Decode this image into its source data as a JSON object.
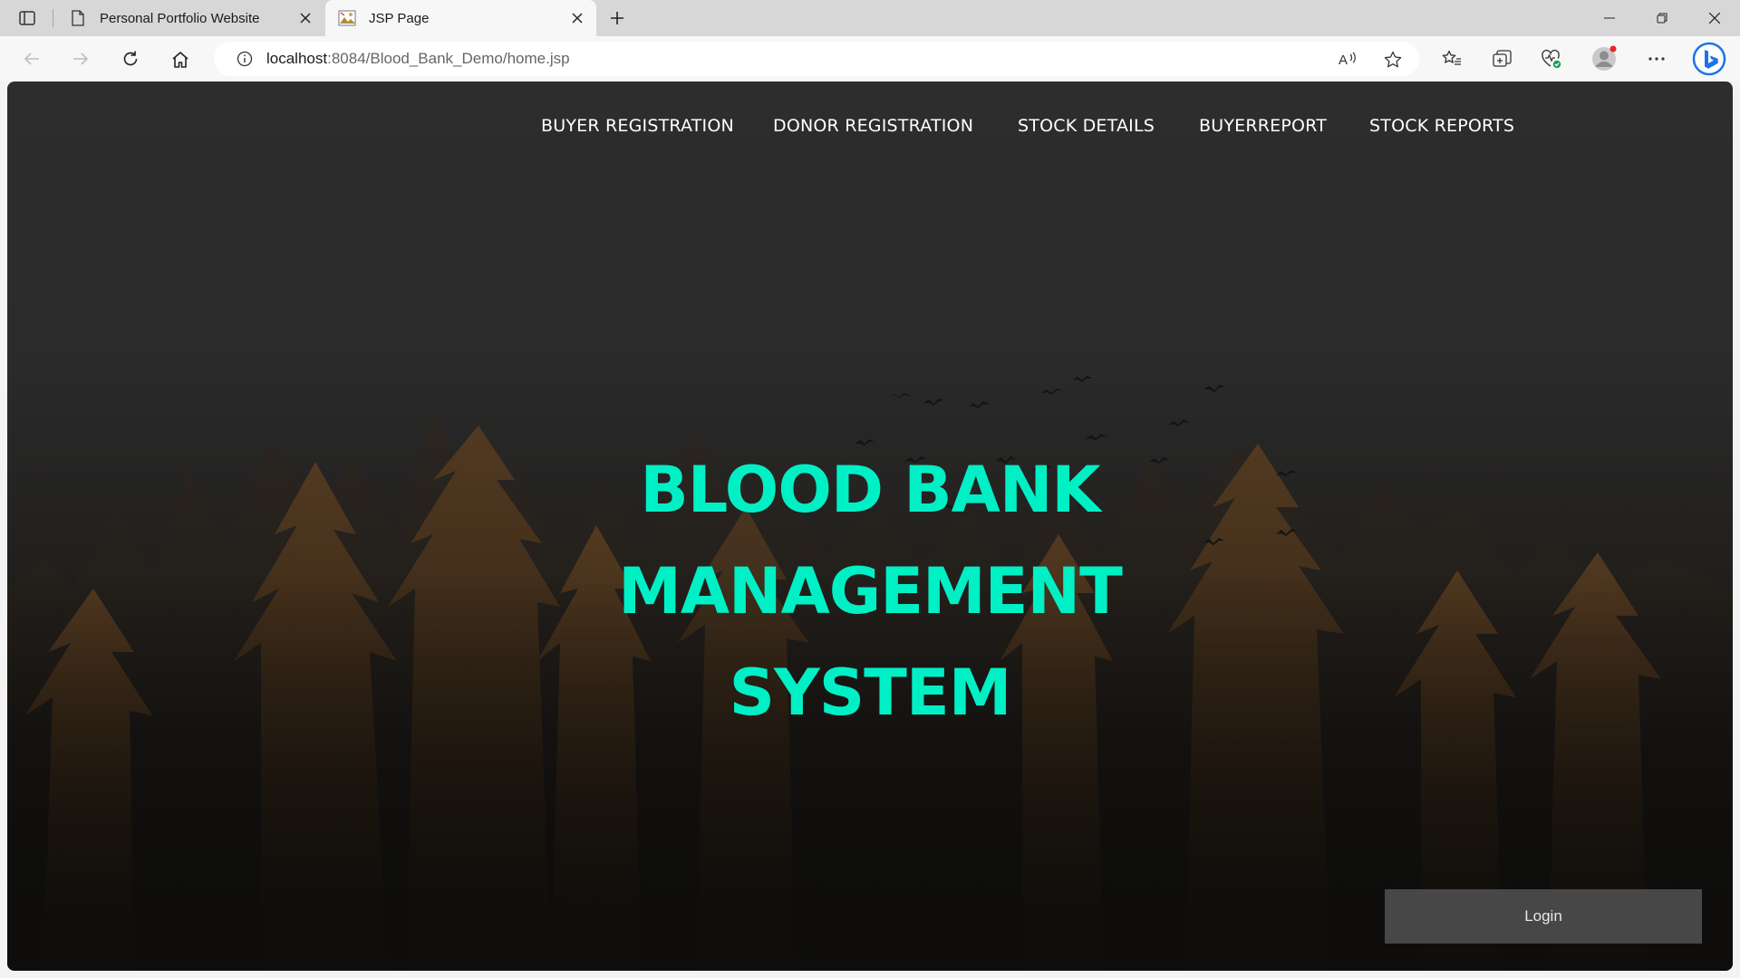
{
  "browser": {
    "tabs": [
      {
        "title": "Personal Portfolio Website",
        "icon": "page-icon",
        "active": false
      },
      {
        "title": "JSP Page",
        "icon": "image-favicon",
        "active": true
      }
    ],
    "url_host": "localhost",
    "url_path": ":8084/Blood_Bank_Demo/home.jsp"
  },
  "page": {
    "nav": [
      "BUYER REGISTRATION",
      "DONOR REGISTRATION",
      "STOCK DETAILS",
      "BUYERREPORT",
      "STOCK REPORTS"
    ],
    "hero_lines": [
      "BLOOD BANK",
      "MANAGEMENT",
      "SYSTEM"
    ],
    "login_label": "Login",
    "colors": {
      "hero_text": "#00f0c6",
      "background": "#2b2b2b",
      "login_button": "#474747"
    }
  }
}
